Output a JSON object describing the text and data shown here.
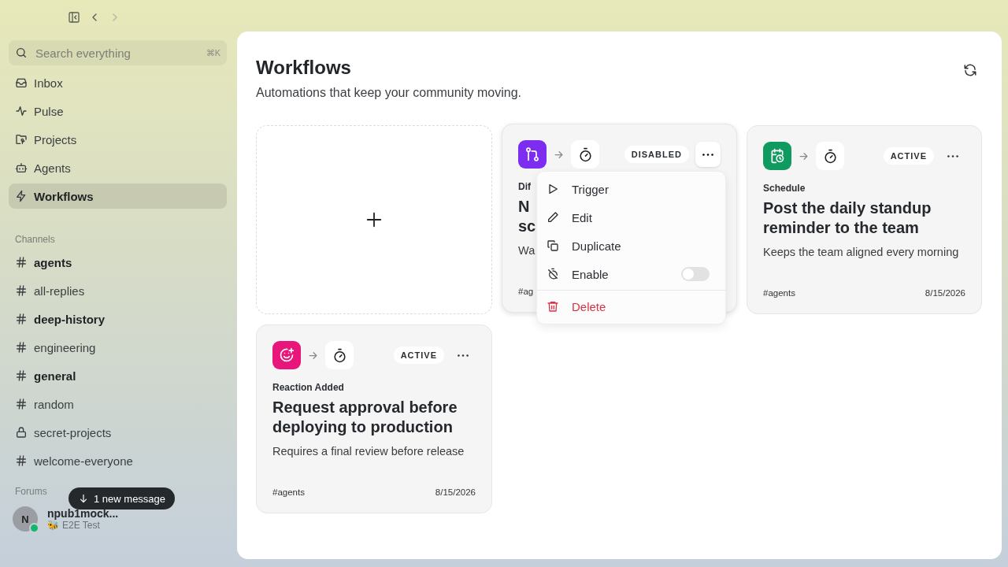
{
  "topbar": {
    "forward_disabled": true
  },
  "search": {
    "placeholder": "Search everything",
    "shortcut": "⌘K"
  },
  "nav": [
    {
      "label": "Inbox",
      "kind": "inbox",
      "selected": false
    },
    {
      "label": "Pulse",
      "kind": "pulse",
      "selected": false
    },
    {
      "label": "Projects",
      "kind": "projects",
      "selected": false
    },
    {
      "label": "Agents",
      "kind": "agents",
      "selected": false
    },
    {
      "label": "Workflows",
      "kind": "workflows",
      "selected": true
    }
  ],
  "channels_heading": "Channels",
  "channels": [
    {
      "name": "agents",
      "kind": "public",
      "unread": true
    },
    {
      "name": "all-replies",
      "kind": "public",
      "unread": false
    },
    {
      "name": "deep-history",
      "kind": "public",
      "unread": true
    },
    {
      "name": "engineering",
      "kind": "public",
      "unread": false
    },
    {
      "name": "general",
      "kind": "public",
      "unread": true
    },
    {
      "name": "random",
      "kind": "public",
      "unread": false
    },
    {
      "name": "secret-projects",
      "kind": "private",
      "unread": false
    },
    {
      "name": "welcome-everyone",
      "kind": "public",
      "unread": false
    }
  ],
  "forums_heading": "Forums",
  "new_message_pill": "1 new message",
  "user": {
    "initial": "N",
    "name": "npub1mock...",
    "status_emoji": "🐝",
    "status": "E2E Test",
    "online": true
  },
  "page": {
    "title": "Workflows",
    "subtitle": "Automations that keep your community moving."
  },
  "cards": [
    {
      "kind": "new"
    },
    {
      "kind": "branch",
      "color": "#7c2df0",
      "status": "DISABLED",
      "menu_open": true,
      "trigger": "Dif",
      "title_lines": [
        "N",
        "sc"
      ],
      "description": "Wa",
      "channel": "#ag"
    },
    {
      "kind": "schedule",
      "color": "#0f9a5f",
      "status": "ACTIVE",
      "menu_open": false,
      "trigger": "Schedule",
      "title_lines": [
        "Post the daily standup",
        "reminder to the team"
      ],
      "description": "Keeps the team aligned every morning",
      "channel": "#agents",
      "date": "8/15/2026"
    },
    {
      "kind": "reaction",
      "color": "#e8157a",
      "status": "ACTIVE",
      "menu_open": false,
      "trigger": "Reaction Added",
      "title_lines": [
        "Request approval before",
        "deploying to production"
      ],
      "description": "Requires a final review before release",
      "channel": "#agents",
      "date": "8/15/2026"
    }
  ],
  "menu": [
    {
      "label": "Trigger",
      "kind": "trigger"
    },
    {
      "label": "Edit",
      "kind": "edit"
    },
    {
      "label": "Duplicate",
      "kind": "duplicate"
    },
    {
      "label": "Enable",
      "kind": "toggle",
      "on": false
    },
    {
      "label": "Delete",
      "kind": "delete"
    }
  ]
}
